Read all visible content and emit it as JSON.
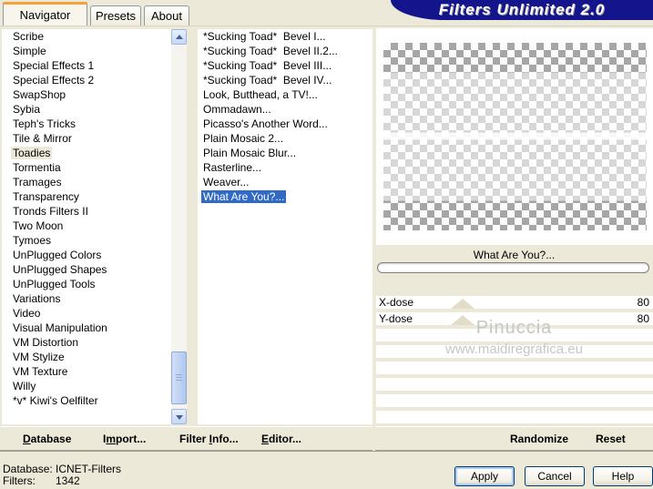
{
  "colors": {
    "dialog_bg": "#ECE9D8",
    "banner_navy": "#14148C",
    "selection_blue": "#316AC5",
    "tab_accent_orange": "#F6A13C",
    "button_border": "#003C74",
    "checker_gray": "#A6A6A6"
  },
  "title_banner": "Filters Unlimited 2.0",
  "tabs": {
    "items": [
      {
        "label": "Navigator",
        "active": true
      },
      {
        "label": "Presets",
        "active": false
      },
      {
        "label": "About",
        "active": false
      }
    ]
  },
  "left_list": {
    "selected": "Toadies",
    "items": [
      "Scribe",
      "Simple",
      "Special Effects 1",
      "Special Effects 2",
      "SwapShop",
      "Sybia",
      "Teph's Tricks",
      "Tile & Mirror",
      "Toadies",
      "Tormentia",
      "Tramages",
      "Transparency",
      "Tronds Filters II",
      "Two Moon",
      "Tymoes",
      "UnPlugged Colors",
      "UnPlugged Shapes",
      "UnPlugged Tools",
      "Variations",
      "Video",
      "Visual Manipulation",
      "VM Distortion",
      "VM Stylize",
      "VM Texture",
      "Willy",
      "*v* Kiwi's Oelfilter"
    ]
  },
  "filter_list": {
    "selected": "What Are You?...",
    "items": [
      "*Sucking Toad*  Bevel I...",
      "*Sucking Toad*  Bevel II.2...",
      "*Sucking Toad*  Bevel III...",
      "*Sucking Toad*  Bevel IV...",
      "Look, Butthead, a TV!...",
      "Ommadawn...",
      "Picasso's Another Word...",
      "Plain Mosaic 2...",
      "Plain Mosaic Blur...",
      "Rasterline...",
      "Weaver...",
      "What Are You?..."
    ]
  },
  "preview": {
    "filter_name": "What Are You?..."
  },
  "sliders": {
    "items": [
      {
        "label": "X-dose",
        "value": "80"
      },
      {
        "label": "Y-dose",
        "value": "80"
      }
    ]
  },
  "watermark": {
    "line1": "Pinuccia",
    "line2": "www.maidiregrafica.eu"
  },
  "toolbar": {
    "database": {
      "pre": "",
      "key": "D",
      "post": "atabase"
    },
    "import": {
      "pre": "I",
      "key": "m",
      "post": "port..."
    },
    "filter_info": {
      "pre": "Filter ",
      "key": "I",
      "post": "nfo..."
    },
    "editor": {
      "pre": "",
      "key": "E",
      "post": "ditor..."
    },
    "randomize": "Randomize",
    "reset": "Reset"
  },
  "status": {
    "db_label": "Database:",
    "db_value": "ICNET-Filters",
    "filters_label": "Filters:",
    "filters_value": "1342"
  },
  "action_buttons": {
    "apply": "Apply",
    "cancel": "Cancel",
    "help": "Help"
  }
}
